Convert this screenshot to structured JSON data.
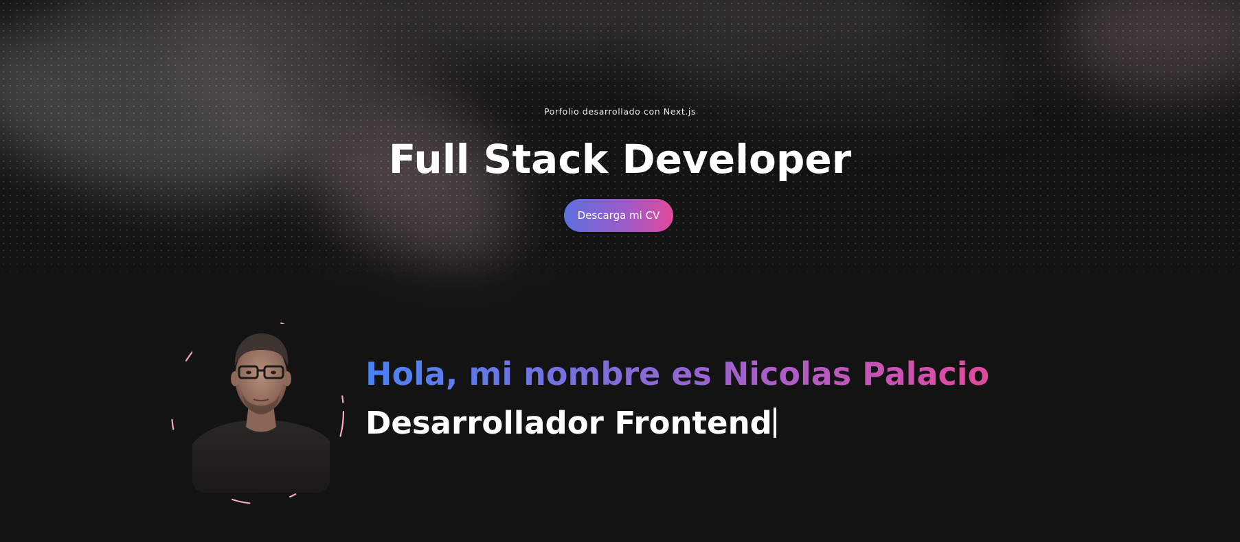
{
  "hero": {
    "subtitle": "Porfolio desarrollado con Next.js",
    "title": "Full Stack Developer",
    "cv_button_label": "Descarga mi CV"
  },
  "about": {
    "greeting": "Hola, mi nombre es Nicolas Palacio",
    "role": "Desarrollador Frontend",
    "avatar_icon": "profile-photo"
  },
  "colors": {
    "background": "#131313",
    "gradient_start": "#4b82f5",
    "gradient_end": "#e2499d",
    "ring": "#f7a8c4"
  }
}
